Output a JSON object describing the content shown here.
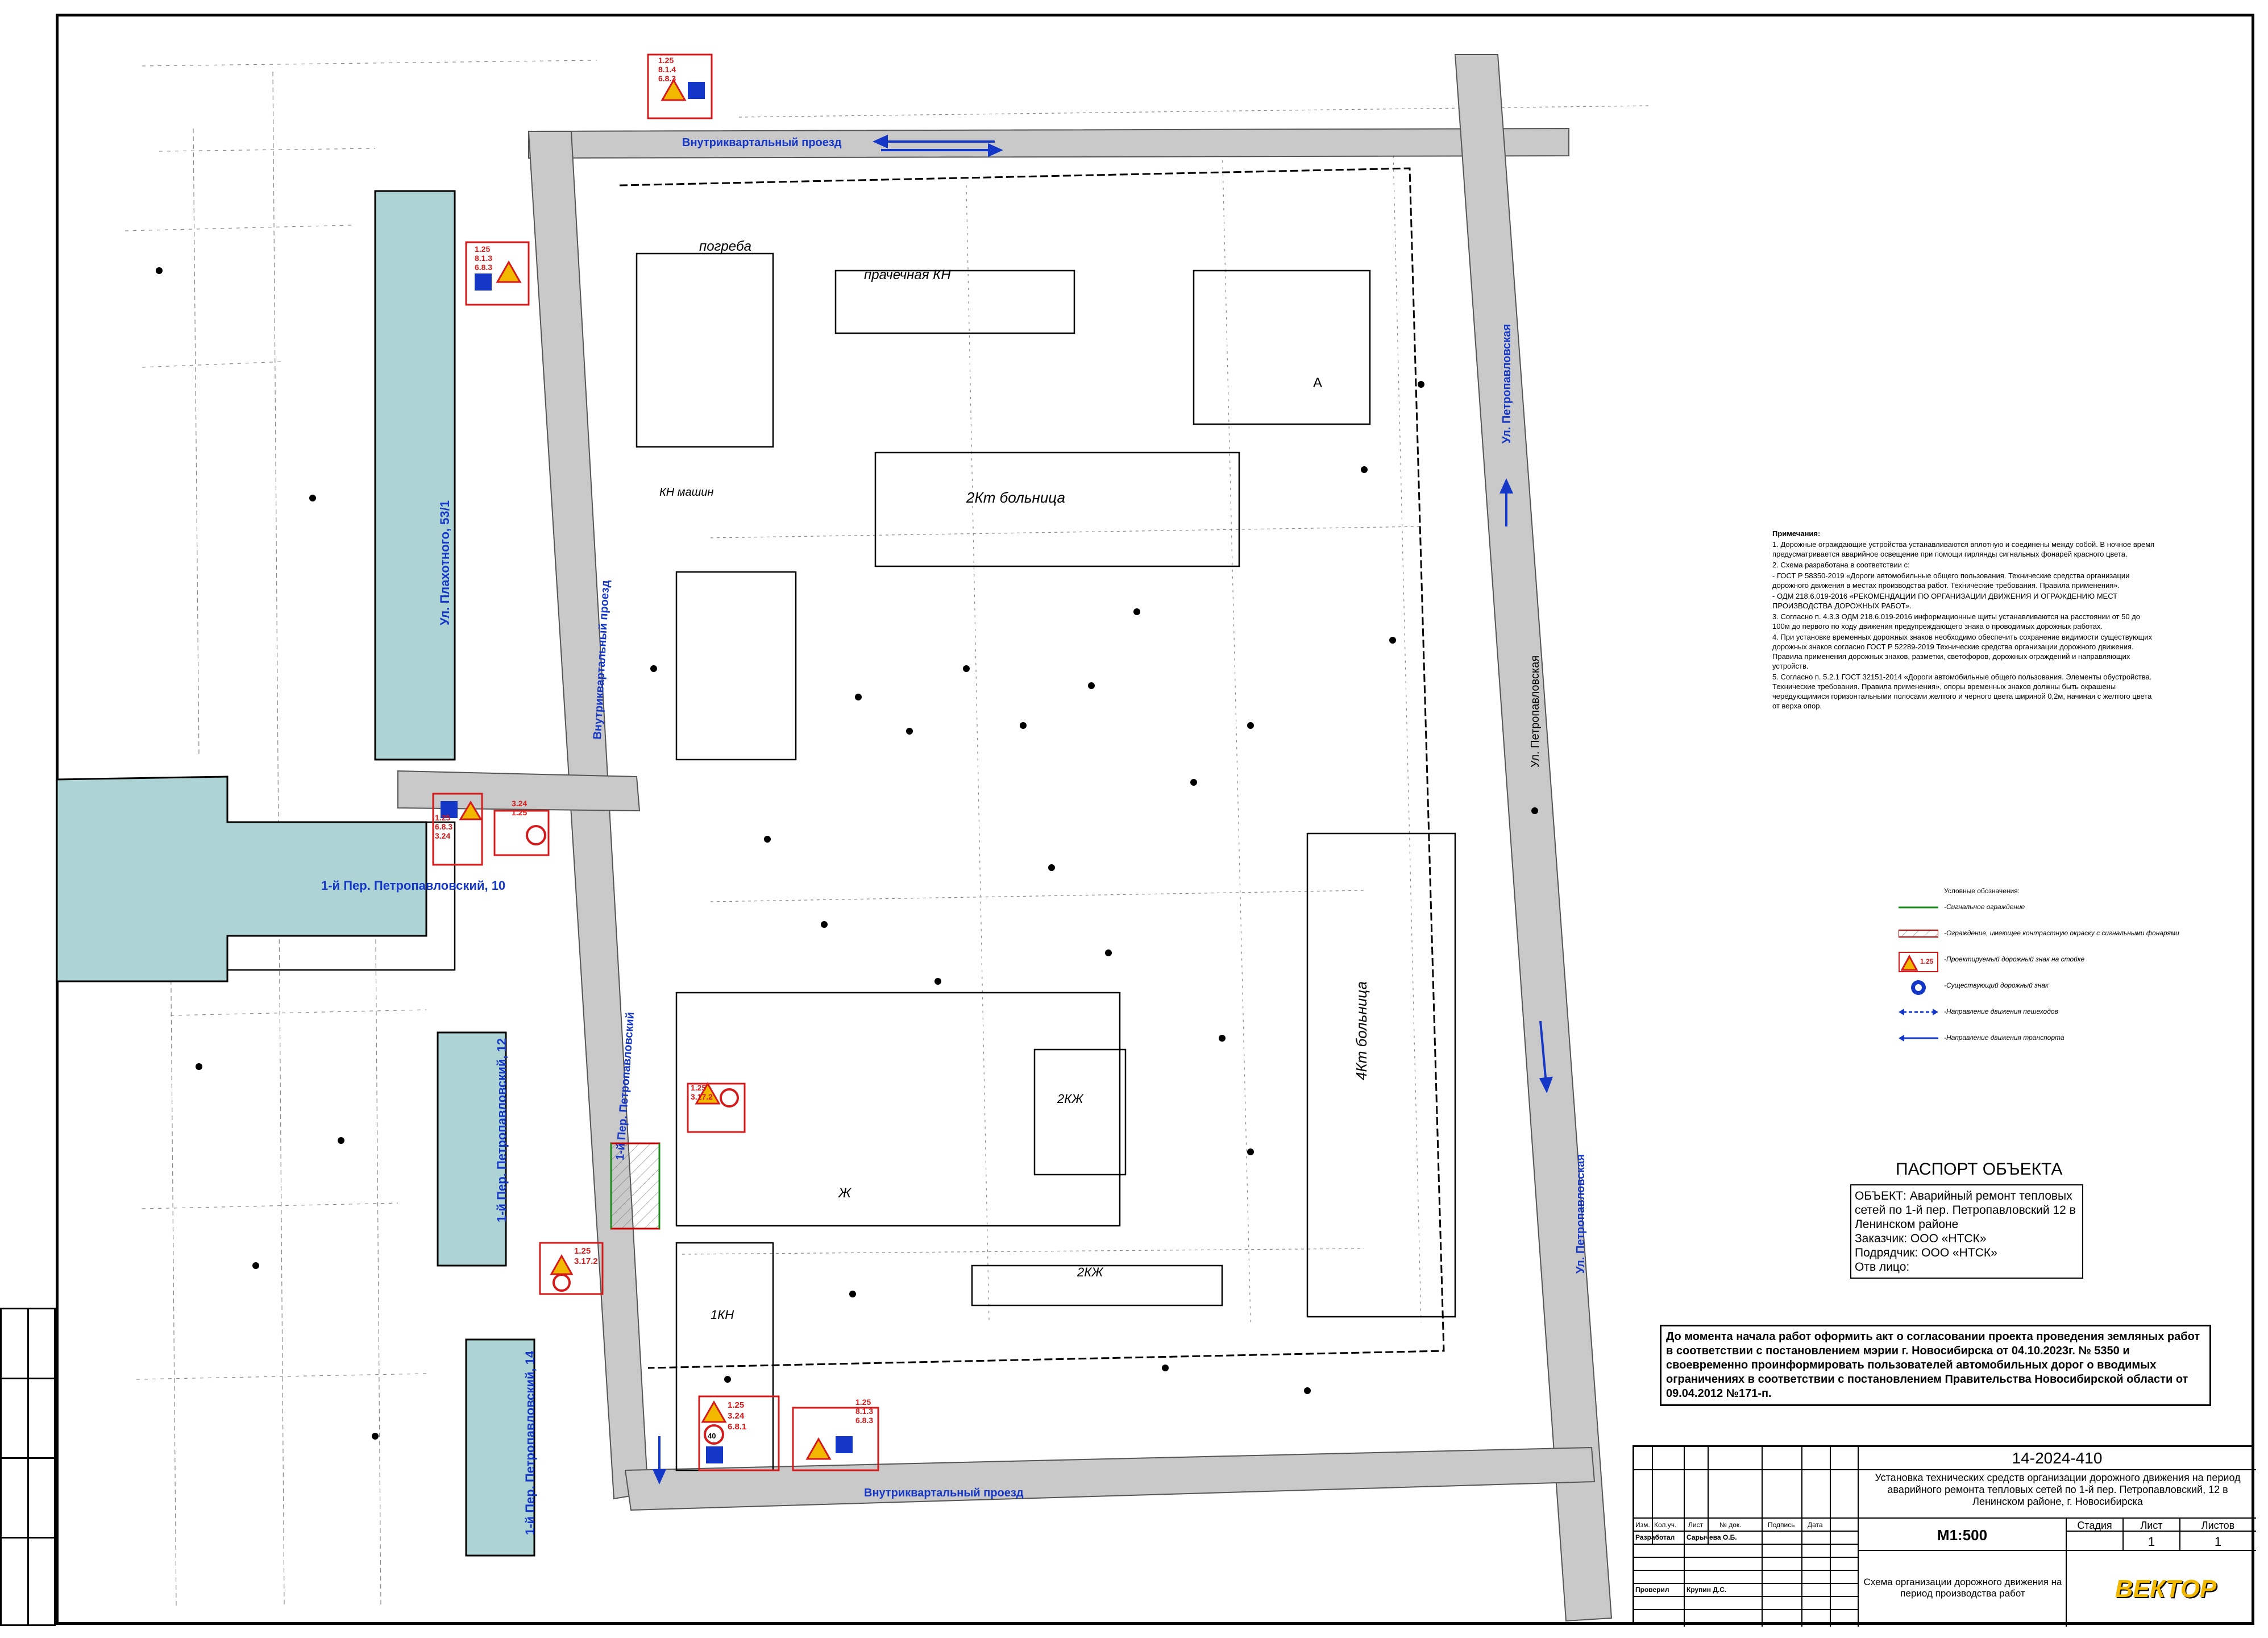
{
  "streets": {
    "inner_top": "Внутриквартальный проезд",
    "inner_bottom": "Внутриквартальный проезд",
    "inner_vertical": "Внутриквартальный проезд",
    "petropavlovsky_lane": "1-й Пер. Петропавловский",
    "petropavlovskaya_upper": "Ул. Петропавловская",
    "petropavlovskaya_lower": "Ул. Петропавловская",
    "petropavlovskaya_mid": "Ул. Петропавловская"
  },
  "buildings": {
    "plakhotnogo": "Ул. Плахотного, 53/1",
    "lane10": "1-й Пер. Петропавловский, 10",
    "lane12": "1-й Пер. Петропавловский, 12",
    "lane14": "1-й Пер. Петропавловский, 14"
  },
  "map_labels": {
    "bolnica_1": "2Кт больница",
    "bolnica_2": "4Кт больница",
    "prachechnaya": "прачечная КН",
    "pogreba": "погреба",
    "kn_mashin": "КН машин",
    "two_kzh": "2КЖ",
    "two_kzh_2": "2КЖ",
    "one_kn": "1КН",
    "zh": "Ж",
    "a": "А"
  },
  "signs": [
    {
      "codes": [
        "1.25",
        "8.1.4",
        "6.8.3"
      ]
    },
    {
      "codes": [
        "1.25",
        "8.1.3",
        "6.8.3"
      ]
    },
    {
      "codes": [
        "1.25",
        "6.8.3",
        "3.24"
      ]
    },
    {
      "codes": [
        "3.24",
        "1.25"
      ]
    },
    {
      "codes": [
        "1.25",
        "3.17.2"
      ]
    },
    {
      "codes": [
        "1.25",
        "3.17.2"
      ]
    },
    {
      "codes": [
        "1.25",
        "3.24",
        "6.8.1"
      ]
    },
    {
      "codes": [
        "1.25",
        "8.1.3",
        "6.8.3"
      ]
    }
  ],
  "speed_limit": "40",
  "notes": {
    "heading": "Примечания:",
    "items": [
      "1. Дорожные ограждающие устройства устанавливаются вплотную и соединены между собой. В ночное время предусматривается аварийное освещение при помощи гирлянды сигнальных фонарей красного цвета.",
      "2. Схема разработана в соответствии с:",
      "- ГОСТ Р 58350-2019 «Дороги автомобильные общего пользования. Технические средства организации дорожного движения в местах производства работ. Технические требования. Правила применения».",
      "- ОДМ 218.6.019-2016 «РЕКОМЕНДАЦИИ ПО ОРГАНИЗАЦИИ ДВИЖЕНИЯ И ОГРАЖДЕНИЮ МЕСТ ПРОИЗВОДСТВА ДОРОЖНЫХ РАБОТ».",
      "3. Согласно п. 4.3.3 ОДМ 218.6.019-2016 информационные щиты устанавливаются на расстоянии от 50 до 100м до первого по ходу движения предупреждающего знака о проводимых дорожных работах.",
      "4. При установке временных дорожных знаков необходимо обеспечить сохранение видимости существующих дорожных знаков согласно ГОСТ Р 52289-2019 Технические средства организации дорожного движения. Правила применения дорожных знаков, разметки, светофоров, дорожных ограждений и направляющих устройств.",
      "5. Согласно п. 5.2.1 ГОСТ 32151-2014 «Дороги автомобильные общего пользования. Элементы обустройства. Технические требования. Правила применения», опоры временных знаков должны быть окрашены чередующимися горизонтальными полосами желтого и черного цвета шириной 0,2м, начиная с желтого цвета от верха опор."
    ]
  },
  "legend": {
    "heading": "Условные обозначения:",
    "fence": "-Сигнальное ограждение",
    "barrier": "-Ограждение, имеющее контрастную окраску с сигнальными фонарями",
    "sign_stand": "-Проектируемый дорожный знак на стойке",
    "existing_sign": "-Существующий дорожный знак",
    "pedestrian_dir": "-Направление движения пешеходов",
    "transport_dir": "-Направление движения транспорта",
    "sample_sign": "1.25"
  },
  "passport": {
    "title": "ПАСПОРТ ОБЪЕКТА",
    "object": "ОБЪЕКТ: Аварийный ремонт тепловых сетей по 1-й пер. Петропавловский 12 в Ленинском районе",
    "customer": "Заказчик: ООО «НТСК»",
    "contractor": "Подрядчик: ООО «НТСК»",
    "responsible": "Отв лицо:"
  },
  "permit_notice": "До момента начала работ оформить акт о согласовании проекта проведения земляных работ в соответствии с постановлением мэрии г. Новосибирска от 04.10.2023г. № 5350 и своевременно проинформировать пользователей автомобильных дорог о вводимых ограничениях в соответствии с постановлением Правительства Новосибирской области от 09.04.2012 №171-п.",
  "title_block": {
    "code": "14-2024-410",
    "description": "Установка технических средств организации дорожного движения на период аварийного ремонта тепловых сетей по 1-й пер. Петропавловский, 12 в Ленинском районе, г. Новосибирска",
    "cols": [
      "Изм.",
      "Кол.уч.",
      "Лист",
      "№ док.",
      "Подпись",
      "Дата"
    ],
    "developed_label": "Разработал",
    "developed_name": "Сарычева О.Б.",
    "checked_label": "Проверил",
    "checked_name": "Крупин Д.С.",
    "scale": "М1:500",
    "stage_label": "Стадия",
    "sheet_label": "Лист",
    "sheets_label": "Листов",
    "stage": "",
    "sheet": "1",
    "sheets": "1",
    "drawing_name": "Схема организации дорожного движения на период производства работ",
    "logo": "ВЕКТОР"
  },
  "colors": {
    "building_fill": "#aed3d5",
    "road_fill": "#c9c9c9",
    "sign_border": "#d41a1a",
    "label_blue": "#1537c8"
  }
}
